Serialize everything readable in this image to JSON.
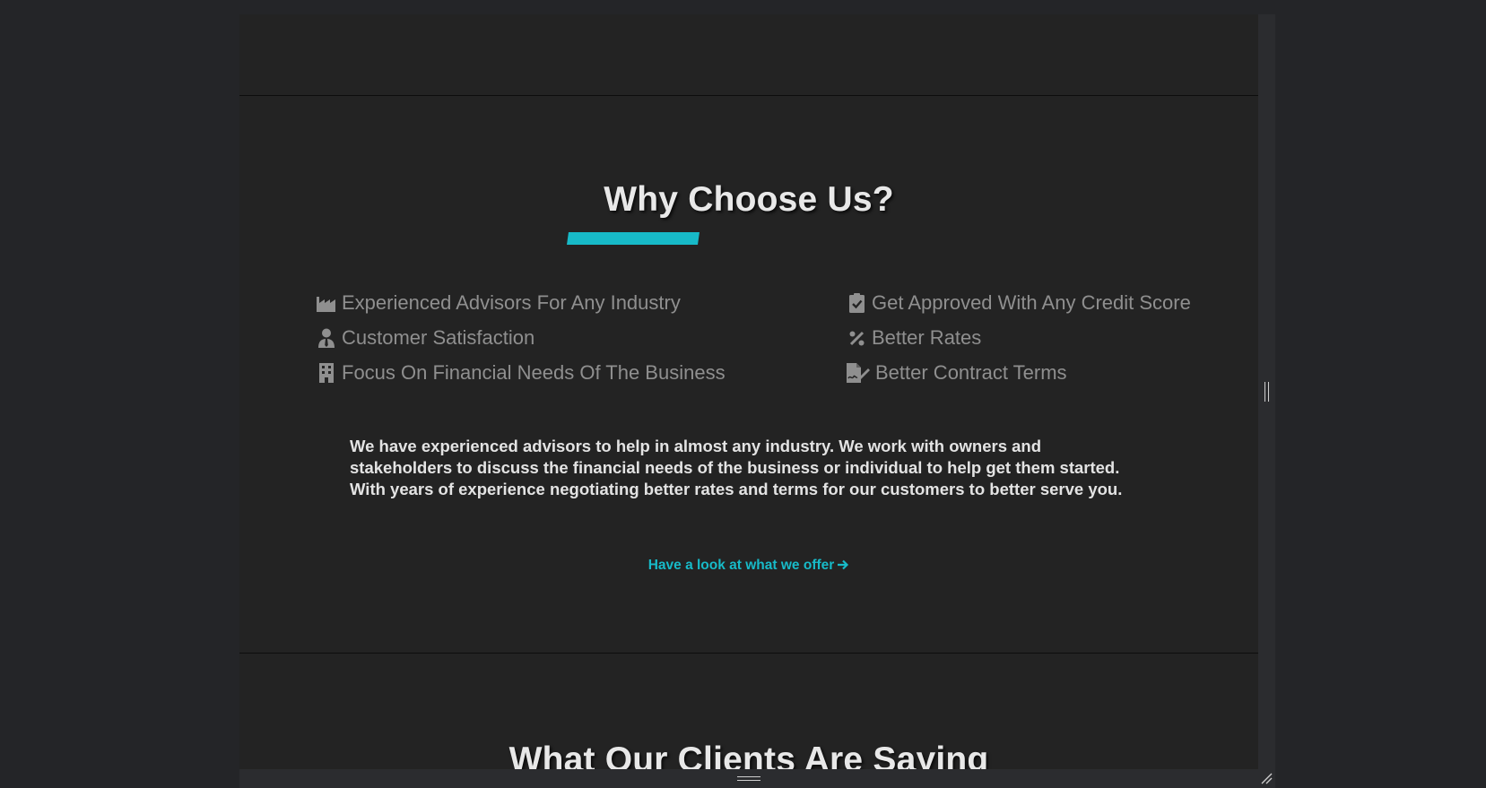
{
  "why_section": {
    "title": "Why Choose Us?",
    "features_left": [
      {
        "icon": "industry-icon",
        "label": "Experienced Advisors For Any Industry"
      },
      {
        "icon": "user-tie-icon",
        "label": "Customer Satisfaction"
      },
      {
        "icon": "building-icon",
        "label": "Focus On Financial Needs Of The Business"
      }
    ],
    "features_right": [
      {
        "icon": "clipboard-check-icon",
        "label": "Get Approved With Any Credit Score"
      },
      {
        "icon": "percent-icon",
        "label": "Better Rates"
      },
      {
        "icon": "file-signature-icon",
        "label": "Better Contract Terms"
      }
    ],
    "description_lines": [
      "We have experienced advisors to help in almost any industry. We work with owners and",
      "stakeholders to discuss the financial needs of the business or individual to help get them started.",
      "With years of experience negotiating better rates and terms for our customers to better serve you."
    ],
    "offer_link": "Have a look at what we offer",
    "offer_link_icon": "arrow-right-icon"
  },
  "clients_section": {
    "title": "What Our Clients Are Saying"
  },
  "colors": {
    "accent": "#17bac8",
    "background": "#232323",
    "feature_text": "#8f8f8f",
    "body_text": "#e3e3e3"
  }
}
